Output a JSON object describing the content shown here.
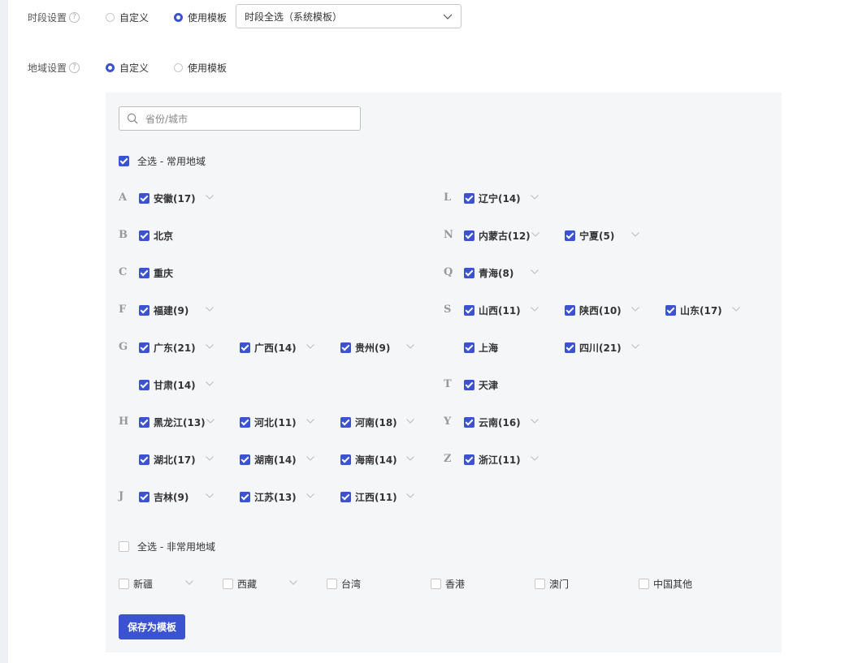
{
  "time_setting": {
    "label": "时段设置",
    "options": [
      "自定义",
      "使用模板"
    ],
    "selected": "使用模板",
    "template_value": "时段全选（系统模板）"
  },
  "region_setting": {
    "label": "地域设置",
    "options": [
      "自定义",
      "使用模板"
    ],
    "selected": "自定义"
  },
  "search": {
    "placeholder": "省份/城市"
  },
  "common": {
    "select_all_label": "全选 - 常用地域",
    "checked": true,
    "groups": [
      {
        "letter": "A",
        "provinces": [
          {
            "name": "安徽(17)",
            "checked": true,
            "expandable": true
          }
        ]
      },
      {
        "letter": "B",
        "provinces": [
          {
            "name": "北京",
            "checked": true,
            "expandable": false
          }
        ]
      },
      {
        "letter": "C",
        "provinces": [
          {
            "name": "重庆",
            "checked": true,
            "expandable": false
          }
        ]
      },
      {
        "letter": "F",
        "provinces": [
          {
            "name": "福建(9)",
            "checked": true,
            "expandable": true
          }
        ]
      },
      {
        "letter": "G",
        "provinces": [
          {
            "name": "广东(21)",
            "checked": true,
            "expandable": true
          },
          {
            "name": "广西(14)",
            "checked": true,
            "expandable": true
          },
          {
            "name": "贵州(9)",
            "checked": true,
            "expandable": true
          },
          {
            "name": "甘肃(14)",
            "checked": true,
            "expandable": true
          }
        ]
      },
      {
        "letter": "H",
        "provinces": [
          {
            "name": "黑龙江(13)",
            "checked": true,
            "expandable": true
          },
          {
            "name": "河北(11)",
            "checked": true,
            "expandable": true
          },
          {
            "name": "河南(18)",
            "checked": true,
            "expandable": true
          },
          {
            "name": "湖北(17)",
            "checked": true,
            "expandable": true
          },
          {
            "name": "湖南(14)",
            "checked": true,
            "expandable": true
          },
          {
            "name": "海南(14)",
            "checked": true,
            "expandable": true
          }
        ]
      },
      {
        "letter": "J",
        "provinces": [
          {
            "name": "吉林(9)",
            "checked": true,
            "expandable": true
          },
          {
            "name": "江苏(13)",
            "checked": true,
            "expandable": true
          },
          {
            "name": "江西(11)",
            "checked": true,
            "expandable": true
          }
        ]
      },
      {
        "letter": "L",
        "provinces": [
          {
            "name": "辽宁(14)",
            "checked": true,
            "expandable": true
          }
        ]
      },
      {
        "letter": "N",
        "provinces": [
          {
            "name": "内蒙古(12)",
            "checked": true,
            "expandable": true
          },
          {
            "name": "宁夏(5)",
            "checked": true,
            "expandable": true
          }
        ]
      },
      {
        "letter": "Q",
        "provinces": [
          {
            "name": "青海(8)",
            "checked": true,
            "expandable": true
          }
        ]
      },
      {
        "letter": "S",
        "provinces": [
          {
            "name": "山西(11)",
            "checked": true,
            "expandable": true
          },
          {
            "name": "陕西(10)",
            "checked": true,
            "expandable": true
          },
          {
            "name": "山东(17)",
            "checked": true,
            "expandable": true
          },
          {
            "name": "上海",
            "checked": true,
            "expandable": false
          },
          {
            "name": "四川(21)",
            "checked": true,
            "expandable": true
          }
        ]
      },
      {
        "letter": "T",
        "provinces": [
          {
            "name": "天津",
            "checked": true,
            "expandable": false
          }
        ]
      },
      {
        "letter": "Y",
        "provinces": [
          {
            "name": "云南(16)",
            "checked": true,
            "expandable": true
          }
        ]
      },
      {
        "letter": "Z",
        "provinces": [
          {
            "name": "浙江(11)",
            "checked": true,
            "expandable": true
          }
        ]
      }
    ]
  },
  "uncommon": {
    "select_all_label": "全选 - 非常用地域",
    "checked": false,
    "items": [
      {
        "name": "新疆",
        "checked": false,
        "expandable": true
      },
      {
        "name": "西藏",
        "checked": false,
        "expandable": true
      },
      {
        "name": "台湾",
        "checked": false,
        "expandable": false
      },
      {
        "name": "香港",
        "checked": false,
        "expandable": false
      },
      {
        "name": "澳门",
        "checked": false,
        "expandable": false
      },
      {
        "name": "中国其他",
        "checked": false,
        "expandable": false
      }
    ]
  },
  "save_button": "保存为模板"
}
